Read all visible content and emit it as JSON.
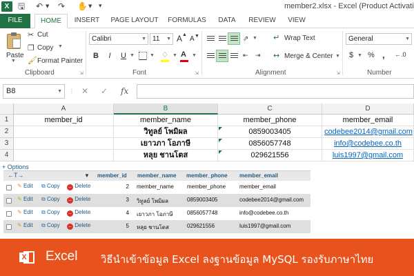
{
  "window": {
    "title": "member2.xlsx - Excel (Product Activati",
    "app_icon": "excel-logo-icon",
    "quick_access": [
      "save-icon",
      "undo-icon",
      "redo-icon",
      "touch-mode-icon"
    ]
  },
  "ribbon": {
    "tabs": [
      "FILE",
      "HOME",
      "INSERT",
      "PAGE LAYOUT",
      "FORMULAS",
      "DATA",
      "REVIEW",
      "VIEW"
    ],
    "active_tab": "HOME",
    "clipboard": {
      "paste": "Paste",
      "cut": "Cut",
      "copy": "Copy",
      "format_painter": "Format Painter",
      "group_label": "Clipboard"
    },
    "font": {
      "font_name": "Calibri",
      "font_size": "11",
      "bold": "B",
      "italic": "I",
      "underline": "U",
      "grow": "A",
      "shrink": "A",
      "font_color_letter": "A",
      "group_label": "Font"
    },
    "alignment": {
      "wrap_text": "Wrap Text",
      "merge_center": "Merge & Center",
      "group_label": "Alignment"
    },
    "number": {
      "format": "General",
      "currency": "$",
      "percent": "%",
      "comma": ",",
      "group_label": "Number"
    }
  },
  "formula_bar": {
    "name_box": "B8",
    "cancel": "✕",
    "enter": "✓",
    "fx": "fx",
    "value": ""
  },
  "sheet": {
    "columns": [
      "A",
      "B",
      "C",
      "D"
    ],
    "selected_column": "B",
    "rows": [
      "1",
      "2",
      "3",
      "4"
    ],
    "headers": [
      "member_id",
      "member_name",
      "member_phone",
      "member_email"
    ],
    "data": [
      [
        "",
        "วิทูลย์ โพมิผล",
        "0859003405",
        "codebee2014@gmail.com"
      ],
      [
        "",
        "เยาวภา โอภาษี",
        "0856057748",
        "info@codebee.co.th"
      ],
      [
        "",
        "หลุย ชานโตส",
        "029621556",
        "luis1997@gmail.com"
      ]
    ]
  },
  "phpmyadmin": {
    "options_link": "+ Options",
    "columns": [
      "member_id",
      "member_name",
      "member_phone",
      "member_email"
    ],
    "actions": {
      "edit": "Edit",
      "copy": "Copy",
      "delete": "Delete"
    },
    "rows": [
      {
        "id": "2",
        "name": "member_name",
        "phone": "member_phone",
        "email": "member_email"
      },
      {
        "id": "3",
        "name": "วิทูลย์ โพมิผล",
        "phone": "0859003405",
        "email": "codebee2014@gmail.com"
      },
      {
        "id": "4",
        "name": "เยาวภา โอภาษี",
        "phone": "0856057748",
        "email": "info@codebee.co.th"
      },
      {
        "id": "5",
        "name": "หลุย ชานโตส",
        "phone": "029621556",
        "email": "luis1997@gmail.com"
      }
    ]
  },
  "banner": {
    "app_name": "Excel",
    "caption": "วิธีนำเข้าข้อมูล Excel ลงฐานข้อมูล MySQL รองรับภาษาไทย",
    "background": "#e8521d"
  },
  "colors": {
    "excel_green": "#217346",
    "link_blue": "#0563c1",
    "pma_blue": "#235a81"
  }
}
